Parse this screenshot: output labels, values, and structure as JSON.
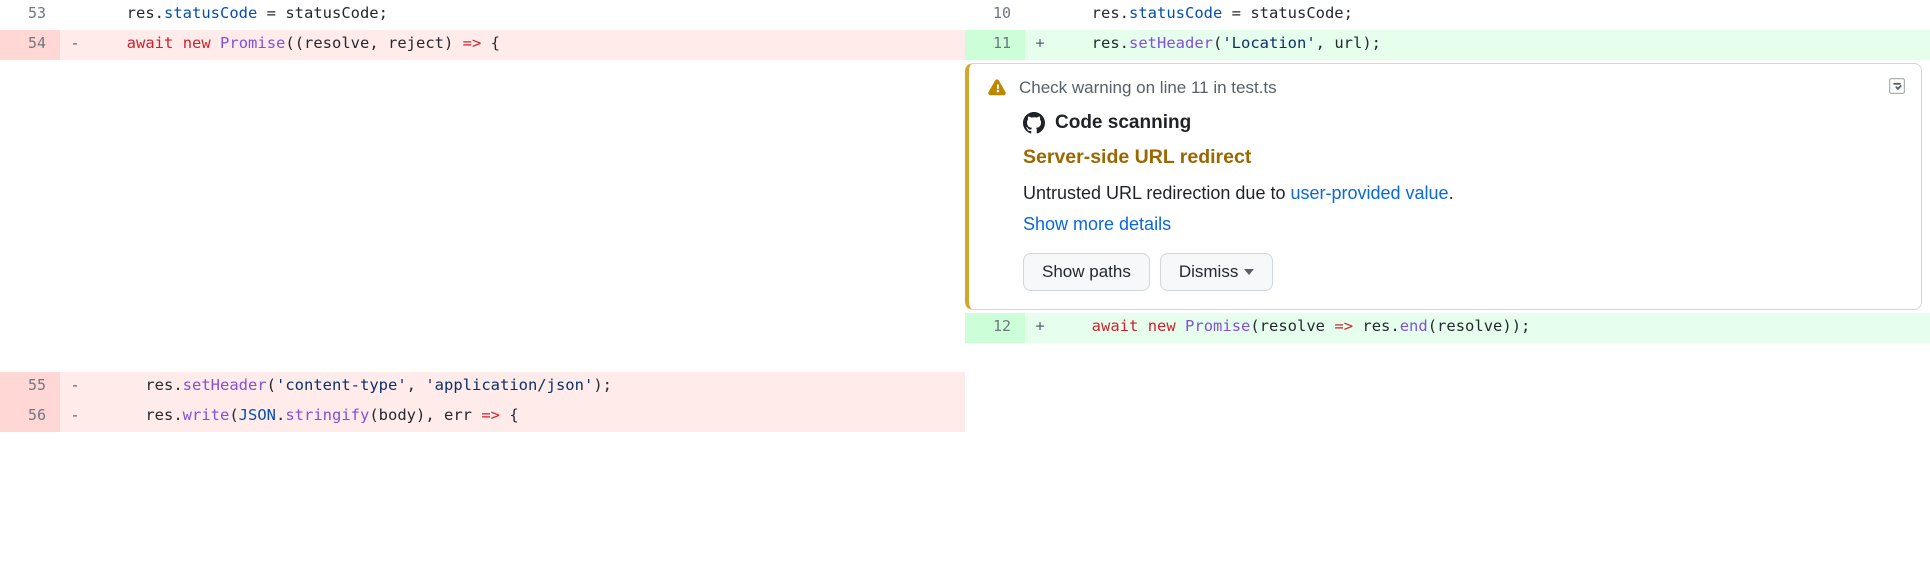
{
  "diff": {
    "left": [
      {
        "num": "53",
        "marker": "",
        "type": "context",
        "code_html": "  res.<span class='tok-prop'>statusCode</span> = statusCode;"
      },
      {
        "num": "54",
        "marker": "-",
        "type": "del",
        "code_html": "  <span class='tok-kw'>await</span> <span class='tok-kw'>new</span> <span class='tok-fn'>Promise</span>((resolve, reject) <span class='tok-kw'>=&gt;</span> {"
      },
      {
        "num": "55",
        "marker": "-",
        "type": "del",
        "code_html": "    res.<span class='tok-fn'>setHeader</span>(<span class='tok-str'>'content-type'</span>, <span class='tok-str'>'application/json'</span>);"
      },
      {
        "num": "56",
        "marker": "-",
        "type": "del",
        "code_html": "    res.<span class='tok-fn'>write</span>(<span class='tok-prop'>JSON</span>.<span class='tok-fn'>stringify</span>(body), err <span class='tok-kw'>=&gt;</span> {"
      }
    ],
    "right": [
      {
        "num": "10",
        "marker": "",
        "type": "context",
        "code_html": "  res.<span class='tok-prop'>statusCode</span> = statusCode;"
      },
      {
        "num": "11",
        "marker": "+",
        "type": "add",
        "code_html": "  res.<span class='tok-fn'>setHeader</span>(<span class='tok-str'>'Location'</span>, url);"
      },
      {
        "num": "12",
        "marker": "+",
        "type": "add",
        "code_html": "  <span class='tok-kw'>await</span> <span class='tok-kw'>new</span> <span class='tok-fn'>Promise</span>(resolve <span class='tok-kw'>=&gt;</span> res.<span class='tok-fn'>end</span>(resolve));"
      }
    ]
  },
  "annotation": {
    "header": "Check warning on line 11 in test.ts",
    "source": "Code scanning",
    "title": "Server-side URL redirect",
    "description_pre": "Untrusted URL redirection due to ",
    "description_link": "user-provided value",
    "description_post": ".",
    "show_more": "Show more details",
    "show_paths_label": "Show paths",
    "dismiss_label": "Dismiss"
  }
}
